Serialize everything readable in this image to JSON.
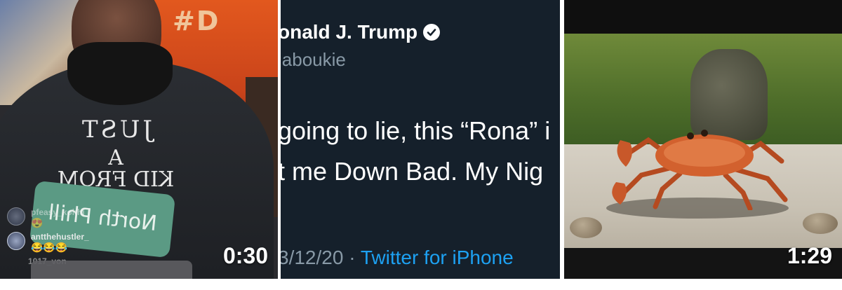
{
  "videos": [
    {
      "shirt_lines": [
        "JUST",
        "A",
        "KID FROM"
      ],
      "shirt_band": "North Phill",
      "wall_sign": "#D",
      "comments": [
        {
          "user": "pfeasy_kohhi",
          "emoji": "😍"
        },
        {
          "user": "antthehustler_",
          "emoji": "😂😂😂"
        },
        {
          "user": "1017_von",
          "emoji": ""
        }
      ],
      "duration": "0:30"
    },
    {
      "tweet": {
        "name": "onald J. Trump",
        "handle": "jaboukie",
        "line1": "going to lie, this “Rona” i",
        "line2": "t me Down Bad. My Nig",
        "date": "3/12/20",
        "separator": "·",
        "source": "Twitter for iPhone"
      }
    },
    {
      "duration": "1:29"
    }
  ],
  "colors": {
    "tweet_bg": "#15202b",
    "tweet_link": "#1da1f2",
    "tweet_muted": "#8899a6",
    "background": "#ffffff"
  },
  "icons": {
    "verified": "verified-badge-icon",
    "comment_avatar": "avatar"
  }
}
